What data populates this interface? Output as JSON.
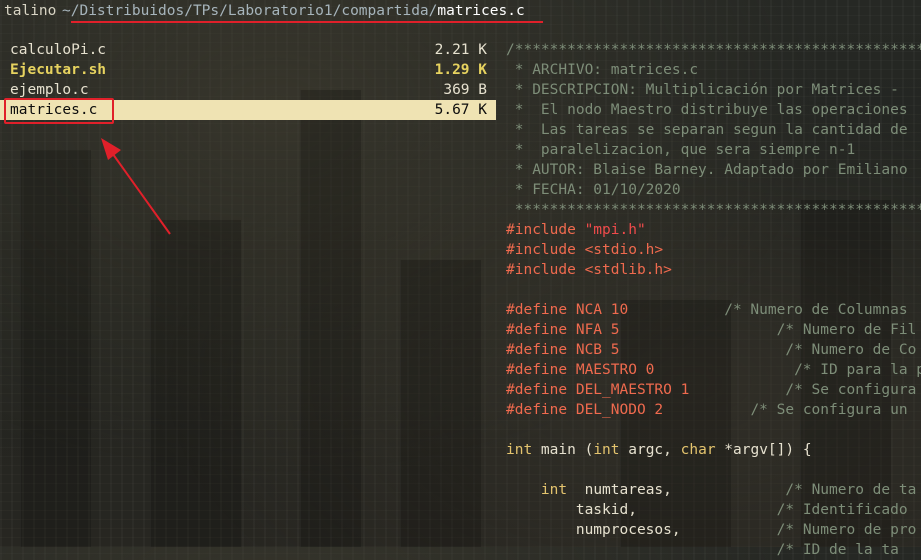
{
  "titlebar": {
    "host": "talino",
    "path_prefix": "~/Distribuidos/TPs/Laboratorio1/compartida/",
    "current_file": "matrices.c"
  },
  "files": [
    {
      "name": "calculoPi.c",
      "size": "2.21 K",
      "kind": "normal"
    },
    {
      "name": "Ejecutar.sh",
      "size": "1.29 K",
      "kind": "exec"
    },
    {
      "name": "ejemplo.c",
      "size": "369 B",
      "kind": "normal"
    },
    {
      "name": "matrices.c",
      "size": "5.67 K",
      "kind": "selected"
    }
  ],
  "preview_lines": [
    [
      {
        "t": "/*****************************************************",
        "c": "cm"
      }
    ],
    [
      {
        "t": " * ARCHIVO: matrices.c",
        "c": "cm"
      }
    ],
    [
      {
        "t": " * DESCRIPCION: Multiplicación por Matrices - ",
        "c": "cm"
      }
    ],
    [
      {
        "t": " *  El nodo Maestro distribuye las operaciones",
        "c": "cm"
      }
    ],
    [
      {
        "t": " *  Las tareas se separan segun la cantidad de",
        "c": "cm"
      }
    ],
    [
      {
        "t": " *  paralelizacion, que sera siempre n-1",
        "c": "cm"
      }
    ],
    [
      {
        "t": " * AUTOR: Blaise Barney. Adaptado por Emiliano",
        "c": "cm"
      }
    ],
    [
      {
        "t": " * FECHA: 01/10/2020",
        "c": "cm"
      }
    ],
    [
      {
        "t": " *****************************************************",
        "c": "cm"
      }
    ],
    [
      {
        "t": "#include ",
        "c": "pp"
      },
      {
        "t": "\"mpi.h\"",
        "c": "str"
      }
    ],
    [
      {
        "t": "#include <stdio.h>",
        "c": "pp"
      }
    ],
    [
      {
        "t": "#include <stdlib.h>",
        "c": "pp"
      }
    ],
    [
      {
        "t": "",
        "c": "txt"
      }
    ],
    [
      {
        "t": "#define NCA 10",
        "c": "pp"
      },
      {
        "t": "           /* Numero de Columnas",
        "c": "cm"
      }
    ],
    [
      {
        "t": "#define NFA 5",
        "c": "pp"
      },
      {
        "t": "                  /* Numero de Fil",
        "c": "cm"
      }
    ],
    [
      {
        "t": "#define NCB 5",
        "c": "pp"
      },
      {
        "t": "                   /* Numero de Co",
        "c": "cm"
      }
    ],
    [
      {
        "t": "#define MAESTRO 0",
        "c": "pp"
      },
      {
        "t": "                /* ID para la p",
        "c": "cm"
      }
    ],
    [
      {
        "t": "#define DEL_MAESTRO 1",
        "c": "pp"
      },
      {
        "t": "           /* Se configura",
        "c": "cm"
      }
    ],
    [
      {
        "t": "#define DEL_NODO 2",
        "c": "pp"
      },
      {
        "t": "          /* Se configura un",
        "c": "cm"
      }
    ],
    [
      {
        "t": "",
        "c": "txt"
      }
    ],
    [
      {
        "t": "int",
        "c": "kw"
      },
      {
        "t": " main (",
        "c": "txt"
      },
      {
        "t": "int",
        "c": "kw"
      },
      {
        "t": " argc, ",
        "c": "txt"
      },
      {
        "t": "char",
        "c": "kw"
      },
      {
        "t": " *argv[]) {",
        "c": "txt"
      }
    ],
    [
      {
        "t": "",
        "c": "txt"
      }
    ],
    [
      {
        "t": "    ",
        "c": "txt"
      },
      {
        "t": "int",
        "c": "kw"
      },
      {
        "t": "  numtareas,",
        "c": "txt"
      },
      {
        "t": "             /* Numero de ta",
        "c": "cm"
      }
    ],
    [
      {
        "t": "        taskid,",
        "c": "txt"
      },
      {
        "t": "                /* Identificado",
        "c": "cm"
      }
    ],
    [
      {
        "t": "        numprocesos,",
        "c": "txt"
      },
      {
        "t": "           /* Numero de pro",
        "c": "cm"
      }
    ],
    [
      {
        "t": "        ",
        "c": "txt"
      },
      {
        "t": "                       /* ID de la ta",
        "c": "cm"
      }
    ]
  ],
  "colors": {
    "annotation_red": "#e0202a",
    "selection_bg": "#efe3b3",
    "exec_yellow": "#e7d35f"
  }
}
